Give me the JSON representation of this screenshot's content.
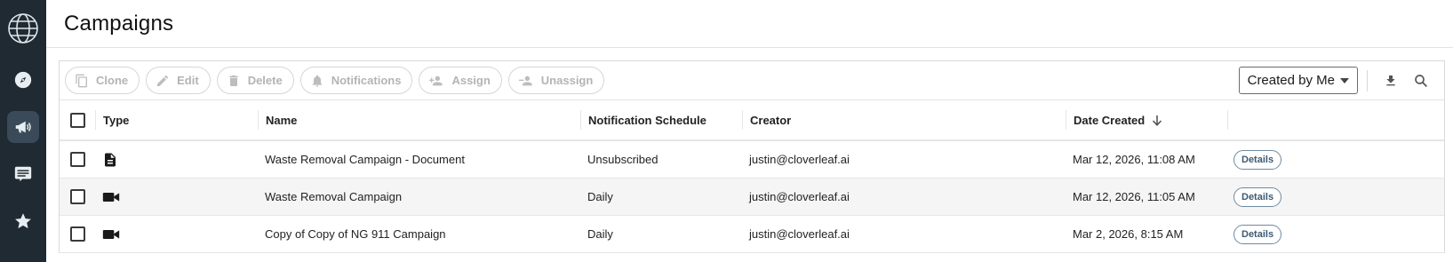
{
  "header": {
    "title": "Campaigns"
  },
  "toolbar": {
    "clone_label": "Clone",
    "edit_label": "Edit",
    "delete_label": "Delete",
    "notifications_label": "Notifications",
    "assign_label": "Assign",
    "unassign_label": "Unassign",
    "filter_value": "Created by Me"
  },
  "table": {
    "columns": {
      "type": "Type",
      "name": "Name",
      "schedule": "Notification Schedule",
      "creator": "Creator",
      "date": "Date Created"
    },
    "rows": [
      {
        "type_icon": "document-icon",
        "name": "Waste Removal Campaign - Document",
        "schedule": "Unsubscribed",
        "creator": "justin@cloverleaf.ai",
        "date": "Mar 12, 2026, 11:08 AM",
        "action": "Details"
      },
      {
        "type_icon": "video-icon",
        "name": "Waste Removal Campaign",
        "schedule": "Daily",
        "creator": "justin@cloverleaf.ai",
        "date": "Mar 12, 2026, 11:05 AM",
        "action": "Details"
      },
      {
        "type_icon": "video-icon",
        "name": "Copy of Copy of NG 911 Campaign",
        "schedule": "Daily",
        "creator": "justin@cloverleaf.ai",
        "date": "Mar 2, 2026, 8:15 AM",
        "action": "Details"
      }
    ]
  },
  "colors": {
    "sidebar_bg": "#1f2a33",
    "sidebar_active": "#3a4a58",
    "disabled_text": "#b4b4b4",
    "details_text": "#3d5a74"
  }
}
